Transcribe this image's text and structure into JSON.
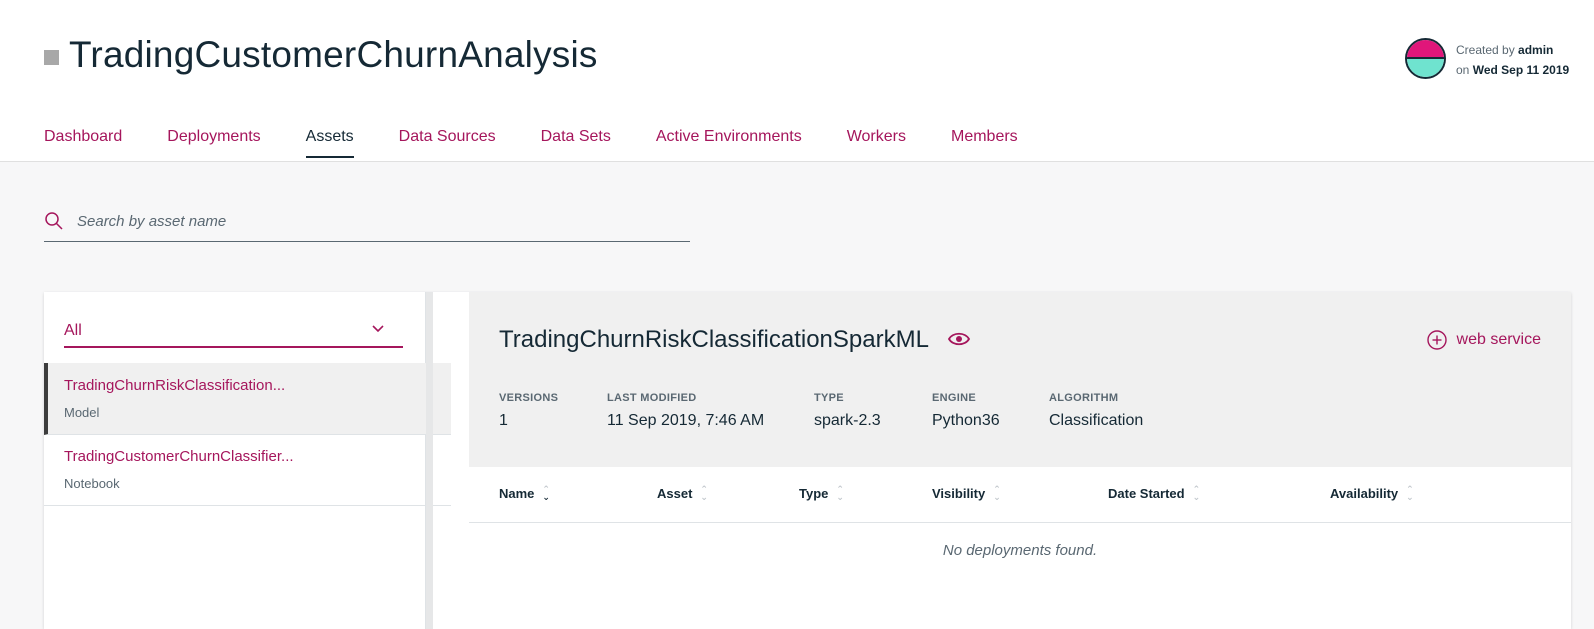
{
  "project": {
    "title": "TradingCustomerChurnAnalysis",
    "created_by_prefix": "Created by",
    "created_by": "admin",
    "created_on_prefix": "on",
    "created_on": "Wed Sep 11 2019",
    "avatar_colors": [
      "#e0167a",
      "#6fe3cf"
    ]
  },
  "tabs": [
    {
      "label": "Dashboard",
      "active": false
    },
    {
      "label": "Deployments",
      "active": false
    },
    {
      "label": "Assets",
      "active": true
    },
    {
      "label": "Data Sources",
      "active": false
    },
    {
      "label": "Data Sets",
      "active": false
    },
    {
      "label": "Active Environments",
      "active": false
    },
    {
      "label": "Workers",
      "active": false
    },
    {
      "label": "Members",
      "active": false
    }
  ],
  "search": {
    "placeholder": "Search by asset name",
    "icon": "search-icon"
  },
  "filter": {
    "selected": "All",
    "icon": "chevron-down-icon"
  },
  "assets": [
    {
      "name": "TradingChurnRiskClassification...",
      "type": "Model",
      "selected": true
    },
    {
      "name": "TradingCustomerChurnClassifier...",
      "type": "Notebook",
      "selected": false
    }
  ],
  "detail": {
    "title": "TradingChurnRiskClassificationSparkML",
    "visibility_icon": "eye-icon",
    "action_label": "web service",
    "action_icon": "plus-circle-icon",
    "meta": [
      {
        "label": "VERSIONS",
        "value": "1"
      },
      {
        "label": "LAST MODIFIED",
        "value": "11 Sep 2019, 7:46 AM"
      },
      {
        "label": "TYPE",
        "value": "spark-2.3"
      },
      {
        "label": "ENGINE",
        "value": "Python36"
      },
      {
        "label": "ALGORITHM",
        "value": "Classification"
      }
    ]
  },
  "table": {
    "columns": [
      "Name",
      "Asset",
      "Type",
      "Visibility",
      "Date Started",
      "Availability"
    ],
    "sorted_column": "Name",
    "empty_text": "No deployments found."
  },
  "colors": {
    "accent": "#a5165c",
    "text": "#152935",
    "secondary": "#5a6872"
  }
}
